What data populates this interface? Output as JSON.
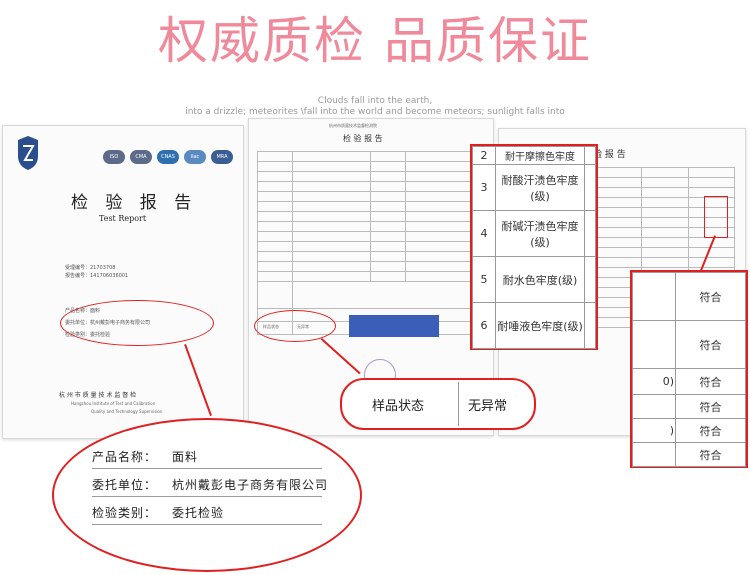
{
  "headline": "权威质检  品质保证",
  "tagline_line1": "Clouds fall into the earth,",
  "tagline_line2": "into a drizzle; meteorites \\fall into the world and become meteors; sunlight falls into",
  "cover": {
    "title": "检 验 报 告",
    "subtitle": "Test Report",
    "badges": [
      "ISO",
      "CMA",
      "CNAS",
      "ilac",
      "MRA"
    ],
    "line_a": "受理编号：21703708",
    "line_b": "报告编号：141706036001",
    "fields": [
      {
        "label": "产品名称：",
        "value": "面料"
      },
      {
        "label": "委托单位：",
        "value": "杭州戴彭电子商务有限公司"
      },
      {
        "label": "检验类别：",
        "value": "委托检验"
      }
    ],
    "institute_cn": "杭 州 市 质 量 技 术 监 督 检",
    "institute_en1": "Hangzhou Institute of Test and Calibration",
    "institute_en2": "Quality and Technology Supervision"
  },
  "middle_doc": {
    "header": "杭州市质量技术监督检测院",
    "title": "检 验 报 告",
    "sample_state_label": "样品状态",
    "sample_state_value": "无异常"
  },
  "zoom_left": {
    "rows": [
      {
        "no": "2",
        "name": "耐干摩擦色牢度"
      },
      {
        "no": "3",
        "name": "耐酸汗渍色牢度(级)"
      },
      {
        "no": "4",
        "name": "耐碱汗渍色牢度(级)"
      },
      {
        "no": "5",
        "name": "耐水色牢度(级)"
      },
      {
        "no": "6",
        "name": "耐唾液色牢度(级)"
      }
    ]
  },
  "zoom_right": {
    "rows": [
      {
        "left": "",
        "result": "符合"
      },
      {
        "left": "",
        "result": "符合"
      },
      {
        "left": "0)",
        "result": "符合"
      },
      {
        "left": "",
        "result": "符合"
      },
      {
        "left": ")",
        "result": "符合"
      },
      {
        "left": "",
        "result": "符合"
      }
    ]
  },
  "zoom_sample": {
    "label": "样品状态",
    "value": "无异常"
  },
  "right_doc": {
    "title": "验 报 告"
  },
  "bottom_info": [
    {
      "label": "产品名称：",
      "value": "面料"
    },
    {
      "label": "委托单位：",
      "value": "杭州戴彭电子商务有限公司"
    },
    {
      "label": "检验类别：",
      "value": "委托检验"
    }
  ]
}
